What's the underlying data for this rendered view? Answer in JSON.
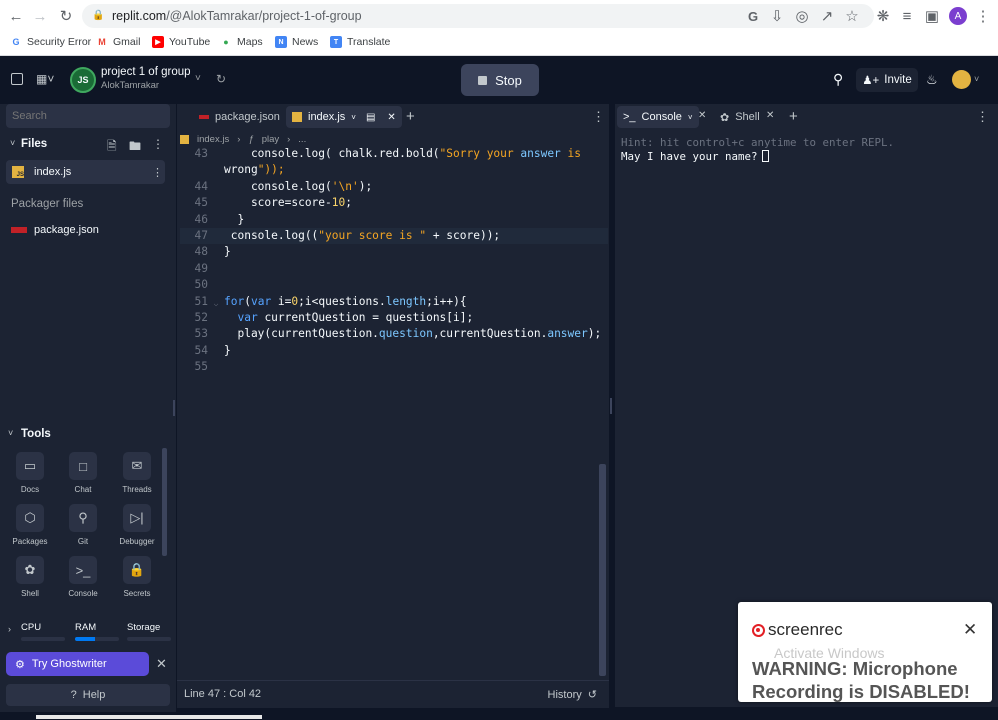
{
  "browser": {
    "url_host": "replit.com",
    "url_path": "/@AlokTamrakar/project-1-of-group",
    "bookmarks": [
      {
        "label": "Security Error",
        "icon": "google-icon"
      },
      {
        "label": "Gmail",
        "icon": "gmail-icon"
      },
      {
        "label": "YouTube",
        "icon": "youtube-icon"
      },
      {
        "label": "Maps",
        "icon": "maps-icon"
      },
      {
        "label": "News",
        "icon": "news-icon"
      },
      {
        "label": "Translate",
        "icon": "translate-icon"
      }
    ],
    "profile_initial": "A"
  },
  "header": {
    "project_title": "project 1 of group",
    "project_owner": "AlokTamrakar",
    "stop_label": "Stop",
    "invite_label": "Invite"
  },
  "sidebar": {
    "search_placeholder": "Search",
    "files_title": "Files",
    "files": [
      {
        "name": "index.js",
        "icon": "js-file-icon"
      }
    ],
    "packager_title": "Packager files",
    "packager_files": [
      {
        "name": "package.json",
        "icon": "npm-icon"
      }
    ],
    "tools_title": "Tools",
    "tools": [
      {
        "label": "Docs",
        "icon": "docs-icon"
      },
      {
        "label": "Chat",
        "icon": "chat-icon"
      },
      {
        "label": "Threads",
        "icon": "threads-icon"
      },
      {
        "label": "Packages",
        "icon": "packages-icon"
      },
      {
        "label": "Git",
        "icon": "git-icon"
      },
      {
        "label": "Debugger",
        "icon": "debugger-icon"
      },
      {
        "label": "Shell",
        "icon": "shell-icon"
      },
      {
        "label": "Console",
        "icon": "console-icon"
      },
      {
        "label": "Secrets",
        "icon": "secrets-icon"
      }
    ],
    "resources": [
      {
        "label": "CPU",
        "level": 0.0
      },
      {
        "label": "RAM",
        "level": 0.45
      },
      {
        "label": "Storage",
        "level": 0.0
      }
    ],
    "ghostwriter_label": "Try Ghostwriter",
    "help_label": "Help"
  },
  "editor": {
    "tabs": [
      {
        "label": "package.json",
        "icon": "npm-icon",
        "active": false
      },
      {
        "label": "index.js",
        "icon": "js-file-icon",
        "active": true
      }
    ],
    "breadcrumb": [
      "index.js",
      "play",
      "..."
    ],
    "lines": [
      {
        "num": "43",
        "text": "    console.log( chalk.red.bold(\"Sorry your answer is"
      },
      {
        "num": "",
        "text": "wrong\"));"
      },
      {
        "num": "44",
        "text": "    console.log('\\n');"
      },
      {
        "num": "45",
        "text": "    score=score-10;"
      },
      {
        "num": "46",
        "text": "  }"
      },
      {
        "num": "47",
        "text": " console.log((\"your score is \" + score));"
      },
      {
        "num": "48",
        "text": "}"
      },
      {
        "num": "49",
        "text": ""
      },
      {
        "num": "50",
        "text": ""
      },
      {
        "num": "51",
        "text": "for(var i=0;i<questions.length;i++){"
      },
      {
        "num": "52",
        "text": "  var currentQuestion = questions[i];"
      },
      {
        "num": "53",
        "text": "  play(currentQuestion.question,currentQuestion.answer);"
      },
      {
        "num": "54",
        "text": "}"
      },
      {
        "num": "55",
        "text": ""
      }
    ],
    "status_position": "Line 47 : Col 42",
    "history_label": "History"
  },
  "console": {
    "tabs": [
      {
        "label": "Console",
        "icon": "terminal-icon",
        "active": true
      },
      {
        "label": "Shell",
        "icon": "shell-icon",
        "active": false
      }
    ],
    "hint": "Hint: hit control+c anytime to enter REPL.",
    "prompt": "May I have your name?"
  },
  "overlay": {
    "brand": "screenrec",
    "activate": "Activate Windows",
    "warning_line1": "WARNING: Microphone",
    "warning_line2": "Recording is DISABLED!"
  }
}
